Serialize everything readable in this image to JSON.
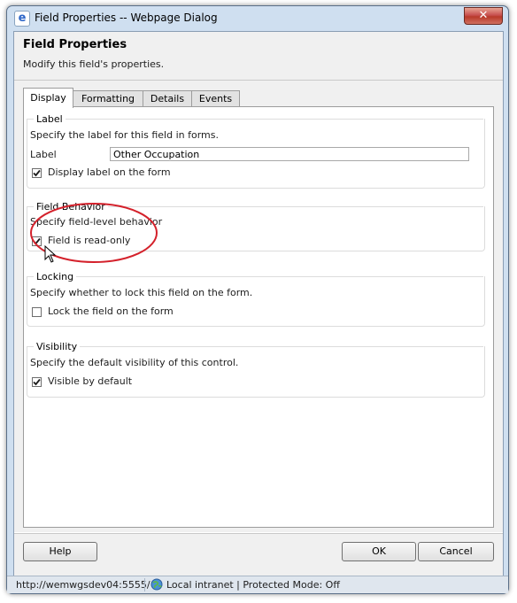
{
  "window": {
    "title": "Field Properties -- Webpage Dialog",
    "close_glyph": "✕",
    "icon": "ie-logo-icon",
    "icon_glyph": "e"
  },
  "header": {
    "title": "Field Properties",
    "subtitle": "Modify this field's properties."
  },
  "tabs": [
    {
      "label": "Display",
      "active": true
    },
    {
      "label": "Formatting",
      "active": false
    },
    {
      "label": "Details",
      "active": false
    },
    {
      "label": "Events",
      "active": false
    }
  ],
  "sections": {
    "label": {
      "legend": "Label",
      "description": "Specify the label for this field in forms.",
      "field_label": "Label",
      "field_value": "Other Occupation",
      "checkbox_label": "Display label on the form",
      "checkbox_checked": true
    },
    "behavior": {
      "legend": "Field Behavior",
      "description": "Specify field-level behavior",
      "checkbox_label": "Field is read-only",
      "checkbox_checked": true
    },
    "locking": {
      "legend": "Locking",
      "description": "Specify whether to lock this field on the form.",
      "checkbox_label": "Lock the field on the form",
      "checkbox_checked": false
    },
    "visibility": {
      "legend": "Visibility",
      "description": "Specify the default visibility of this control.",
      "checkbox_label": "Visible by default",
      "checkbox_checked": true
    }
  },
  "footer": {
    "help_label": "Help",
    "ok_label": "OK",
    "cancel_label": "Cancel"
  },
  "status": {
    "url": "http://wemwgsdev04:5555/",
    "zone": "Local intranet | Protected Mode: Off"
  },
  "colors": {
    "annotation": "#d4212b",
    "frame": "#cfdff0"
  }
}
